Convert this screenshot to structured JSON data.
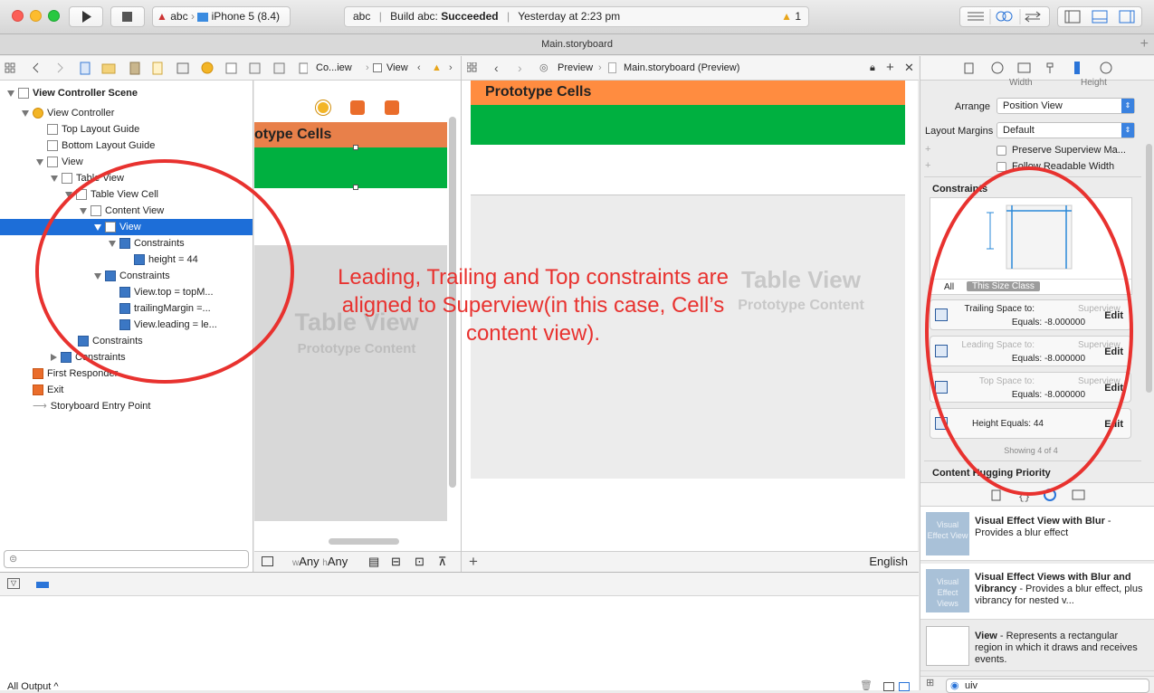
{
  "toolbar": {
    "scheme": "abc",
    "device": "iPhone 5 (8.4)",
    "status_project": "abc",
    "status_build_prefix": "Build abc:",
    "status_build_result": "Succeeded",
    "status_time": "Yesterday at 2:23 pm",
    "warning_count": "1"
  },
  "tab_title": "Main.storyboard",
  "jumpbar_left": {
    "items": [
      "Co...iew",
      "View"
    ]
  },
  "jumpbar_right": {
    "preview": "Preview",
    "file": "Main.storyboard (Preview)"
  },
  "navigator": {
    "rows": [
      {
        "label": "View Controller Scene",
        "bold": true
      },
      {
        "label": "View Controller"
      },
      {
        "label": "Top Layout Guide"
      },
      {
        "label": "Bottom Layout Guide"
      },
      {
        "label": "View"
      },
      {
        "label": "Table View"
      },
      {
        "label": "Table View Cell"
      },
      {
        "label": "Content View"
      },
      {
        "label": "View"
      },
      {
        "label": "Constraints"
      },
      {
        "label": "height = 44"
      },
      {
        "label": "Constraints"
      },
      {
        "label": "View.top = topM..."
      },
      {
        "label": "trailingMargin =..."
      },
      {
        "label": "View.leading = le..."
      },
      {
        "label": "Constraints"
      },
      {
        "label": "Constraints"
      },
      {
        "label": "First Responder"
      },
      {
        "label": "Exit"
      },
      {
        "label": "Storyboard Entry Point"
      }
    ]
  },
  "canvas_left": {
    "prototype_cells": "otype Cells",
    "table_view": "Table View",
    "prototype_content": "Prototype Content",
    "size_w": "Any",
    "size_h": "Any"
  },
  "canvas_right": {
    "prototype_cells": "Prototype Cells",
    "table_view": "Table View",
    "prototype_content": "Prototype Content",
    "language": "English"
  },
  "annotation": {
    "text": "Leading, Trailing and Top constraints are aligned to Superview(in this case, Cell’s content view)."
  },
  "inspector": {
    "width_label": "Width",
    "height_label": "Height",
    "arrange_label": "Arrange",
    "arrange_value": "Position View",
    "margins_label": "Layout Margins",
    "margins_value": "Default",
    "preserve_label": "Preserve Superview Ma...",
    "follow_label": "Follow Readable Width",
    "constraints_title": "Constraints",
    "seg_all": "All",
    "seg_size_class": "This Size Class",
    "constraints": [
      {
        "name": "Trailing Space to:",
        "target": "Superview",
        "equals": "Equals:  -8.000000",
        "edit": "Edit"
      },
      {
        "name": "Leading Space to:",
        "target": "Superview",
        "equals": "Equals:  -8.000000",
        "edit": "Edit"
      },
      {
        "name": "Top Space to:",
        "target": "Superview",
        "equals": "Equals:  -8.000000",
        "edit": "Edit"
      },
      {
        "name": "Height Equals:  44",
        "target": "",
        "equals": "",
        "edit": "Edit"
      }
    ],
    "showing": "Showing 4 of 4",
    "hugging_title": "Content Hugging Priority"
  },
  "library": [
    {
      "thumb": "Visual Effect View",
      "title": "Visual Effect View with Blur",
      "desc": " - Provides a blur effect"
    },
    {
      "thumb": "Visual Effect Views",
      "title": "Visual Effect Views with Blur and Vibrancy",
      "desc": " - Provides a blur effect, plus vibrancy for nested v..."
    },
    {
      "thumb": "",
      "title": "View",
      "desc": " - Represents a rectangular region in which it draws and receives events."
    }
  ],
  "library_search": "uiv",
  "debug": {
    "output_label": "All Output ^"
  },
  "colors": {
    "orange_header": "#ff8c40",
    "orange_header_left": "#e8804a",
    "green_cell": "#00b040",
    "selection": "#1d6ed8",
    "annotation_red": "#e8322f"
  }
}
